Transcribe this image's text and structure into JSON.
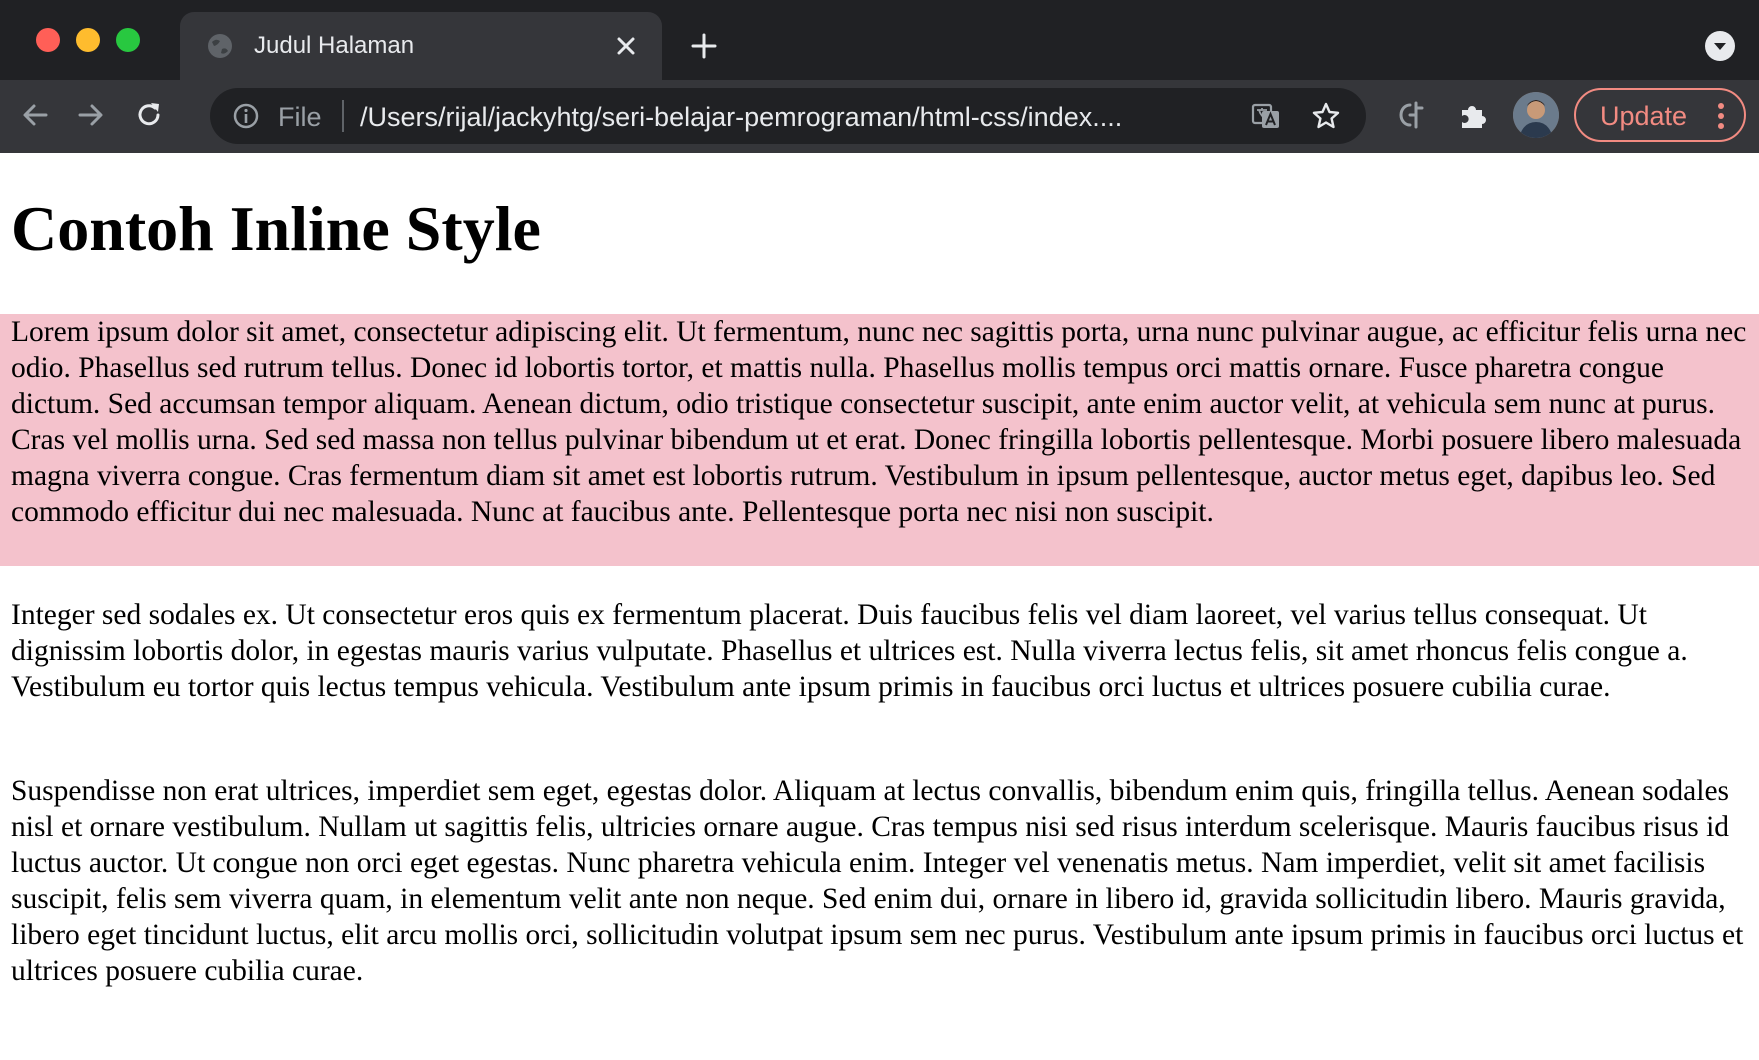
{
  "browser": {
    "tab": {
      "title": "Judul Halaman"
    },
    "omnibox": {
      "scheme_label": "File",
      "url": "/Users/rijal/jackyhtg/seri-belajar-pemrograman/html-css/index...."
    },
    "update_label": "Update"
  },
  "page": {
    "heading": "Contoh Inline Style",
    "highlight_color": "#f4c2cc",
    "paragraphs": [
      "Lorem ipsum dolor sit amet, consectetur adipiscing elit. Ut fermentum, nunc nec sagittis porta, urna nunc pulvinar augue, ac efficitur felis urna nec odio. Phasellus sed rutrum tellus. Donec id lobortis tortor, et mattis nulla. Phasellus mollis tempus orci mattis ornare. Fusce pharetra congue dictum. Sed accumsan tempor aliquam. Aenean dictum, odio tristique consectetur suscipit, ante enim auctor velit, at vehicula sem nunc at purus. Cras vel mollis urna. Sed sed massa non tellus pulvinar bibendum ut et erat. Donec fringilla lobortis pellentesque. Morbi posuere libero malesuada magna viverra congue. Cras fermentum diam sit amet est lobortis rutrum. Vestibulum in ipsum pellentesque, auctor metus eget, dapibus leo. Sed commodo efficitur dui nec malesuada. Nunc at faucibus ante. Pellentesque porta nec nisi non suscipit.",
      "Integer sed sodales ex. Ut consectetur eros quis ex fermentum placerat. Duis faucibus felis vel diam laoreet, vel varius tellus consequat. Ut dignissim lobortis dolor, in egestas mauris varius vulputate. Phasellus et ultrices est. Nulla viverra lectus felis, sit amet rhoncus felis congue a. Vestibulum eu tortor quis lectus tempus vehicula. Vestibulum ante ipsum primis in faucibus orci luctus et ultrices posuere cubilia curae.",
      "Suspendisse non erat ultrices, imperdiet sem eget, egestas dolor. Aliquam at lectus convallis, bibendum enim quis, fringilla tellus. Aenean sodales nisl et ornare vestibulum. Nullam ut sagittis felis, ultricies ornare augue. Cras tempus nisi sed risus interdum scelerisque. Mauris faucibus risus id luctus auctor. Ut congue non orci eget egestas. Nunc pharetra vehicula enim. Integer vel venenatis metus. Nam imperdiet, velit sit amet facilisis suscipit, felis sem viverra quam, in elementum velit ante non neque. Sed enim dui, ornare in libero id, gravida sollicitudin libero. Mauris gravida, libero eget tincidunt luctus, elit arcu mollis orci, sollicitudin volutpat ipsum sem nec purus. Vestibulum ante ipsum primis in faucibus orci luctus et ultrices posuere cubilia curae."
    ]
  }
}
